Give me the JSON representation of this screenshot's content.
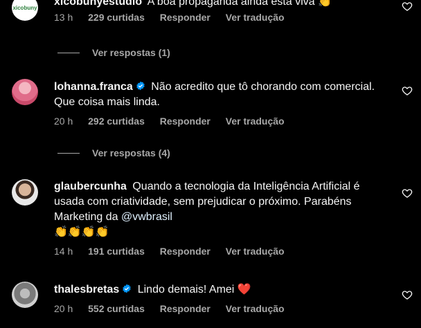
{
  "comments": [
    {
      "username": "xicobunyestudio",
      "avatar_text": "xicobuny",
      "text": "A boa propaganda ainda está viva",
      "emoji": "👏",
      "time": "13 h",
      "likes": "229 curtidas",
      "reply": "Responder",
      "translate": "Ver tradução",
      "view_replies": "Ver respostas (1)"
    },
    {
      "username": "lohanna.franca",
      "verified": true,
      "text": "Não acredito que tô chorando com comercial. Que coisa mais linda.",
      "time": "20 h",
      "likes": "292 curtidas",
      "reply": "Responder",
      "translate": "Ver tradução",
      "view_replies": "Ver respostas (4)"
    },
    {
      "username": "glaubercunha",
      "text": "Quando a tecnologia da Inteligência Artificial é usada com criatividade, sem prejudicar o próximo. Parabéns Marketing da",
      "mention": "@vwbrasil",
      "emoji": "👏👏👏👏",
      "time": "14 h",
      "likes": "191 curtidas",
      "reply": "Responder",
      "translate": "Ver tradução"
    },
    {
      "username": "thalesbretas",
      "verified": true,
      "text": "Lindo demais! Amei",
      "emoji": "❤️",
      "time": "20 h",
      "likes": "552 curtidas",
      "reply": "Responder",
      "translate": "Ver tradução"
    }
  ],
  "colors": {
    "background": "#000000",
    "text": "#f5f5f5",
    "secondary": "#a8a8a8",
    "verified": "#0095f6",
    "heart_emoji": "#ff3040"
  }
}
